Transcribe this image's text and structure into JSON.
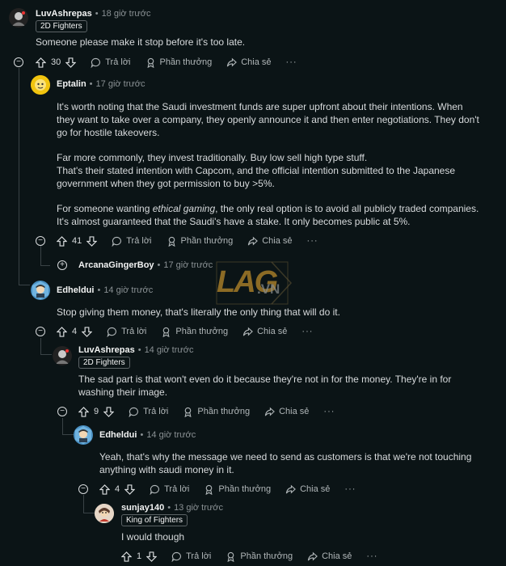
{
  "actions": {
    "reply": "Trả lời",
    "award": "Phần thưởng",
    "share": "Chia sẻ",
    "more": "···"
  },
  "watermark": {
    "text_main": "LAG",
    "text_dot": ".VN"
  },
  "c1": {
    "user": "LuvAshrepas",
    "time": "18 giờ trước",
    "flair": "2D Fighters",
    "body": "Someone please make it stop before it's too late.",
    "votes": "30"
  },
  "c2": {
    "user": "Eptalin",
    "time": "17 giờ trước",
    "votes": "41",
    "p1": "It's worth noting that the Saudi investment funds are super upfront about their intentions. When they want to take over a company, they openly announce it and then enter negotiations. They don't go for hostile takeovers.",
    "p2a": "Far more commonly, they invest traditionally. Buy low sell high type stuff.",
    "p2b": "That's their stated intention with Capcom, and the official intention submitted to the Japanese government when they got permission to buy >5%.",
    "p3_before": "For someone wanting ",
    "p3_em": "ethical gaming",
    "p3_after": ", the only real option is to avoid all publicly traded companies. It's almost guaranteed that the Saudi's have a stake. It only becomes public at 5%."
  },
  "c3": {
    "user": "ArcanaGingerBoy",
    "time": "17 giờ trước",
    "expand": "+"
  },
  "c4": {
    "user": "Edheldui",
    "time": "14 giờ trước",
    "body": "Stop giving them money, that's literally the only thing that will do it.",
    "votes": "4"
  },
  "c5": {
    "user": "LuvAshrepas",
    "time": "14 giờ trước",
    "flair": "2D Fighters",
    "body": "The sad part is that won't even do it because they're not in for the money. They're in for washing their image.",
    "votes": "9"
  },
  "c6": {
    "user": "Edheldui",
    "time": "14 giờ trước",
    "body": "Yeah, that's why the message we need to send as customers is that we're not touching anything with saudi money in it.",
    "votes": "4"
  },
  "c7": {
    "user": "sunjay140",
    "time": "13 giờ trước",
    "flair": "King of Fighters",
    "body": "I would though",
    "votes": "1"
  }
}
